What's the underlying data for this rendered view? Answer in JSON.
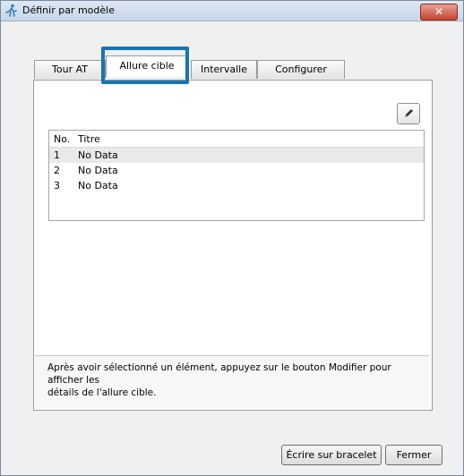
{
  "window": {
    "title": "Définir par modèle",
    "close_label": "✕"
  },
  "tabs": [
    {
      "label": "Tour AT",
      "active": false
    },
    {
      "label": "Allure cible",
      "active": true
    },
    {
      "label": "Intervalle",
      "active": false
    },
    {
      "label": "Configurer",
      "active": false
    }
  ],
  "list": {
    "columns": [
      "No.",
      "Titre"
    ],
    "rows": [
      {
        "no": "1",
        "title": "No Data"
      },
      {
        "no": "2",
        "title": "No Data"
      },
      {
        "no": "3",
        "title": "No Data"
      }
    ]
  },
  "instructions": "Après avoir sélectionné un élément, appuyez sur le bouton Modifier pour afficher les\ndétails de l'allure cible.",
  "buttons": {
    "write_bracelet": "Écrire sur bracelet",
    "close": "Fermer"
  },
  "colors": {
    "highlight": "#1875b4",
    "title_close": "#c5452f"
  },
  "icons": {
    "app": "runner-icon",
    "edit": "pencil-icon"
  }
}
